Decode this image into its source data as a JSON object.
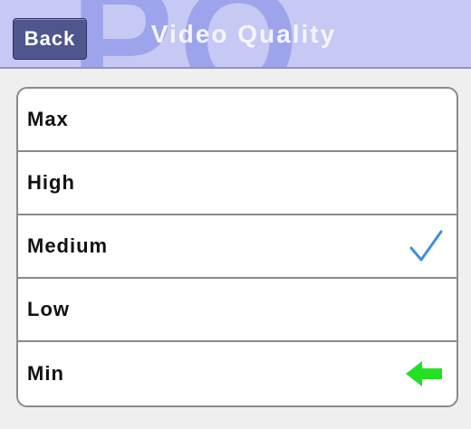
{
  "nav": {
    "watermark": "PO",
    "back_label": "Back",
    "title": "Video Quality"
  },
  "options": [
    {
      "label": "Max",
      "icon": null
    },
    {
      "label": "High",
      "icon": null
    },
    {
      "label": "Medium",
      "icon": "checkmark-icon"
    },
    {
      "label": "Low",
      "icon": null
    },
    {
      "label": "Min",
      "icon": "green-arrow-left-icon"
    }
  ],
  "colors": {
    "nav_background": "#c6c9f4",
    "back_button": "#4f568e",
    "checkmark": "#3f8fe0",
    "arrow": "#22e022"
  }
}
